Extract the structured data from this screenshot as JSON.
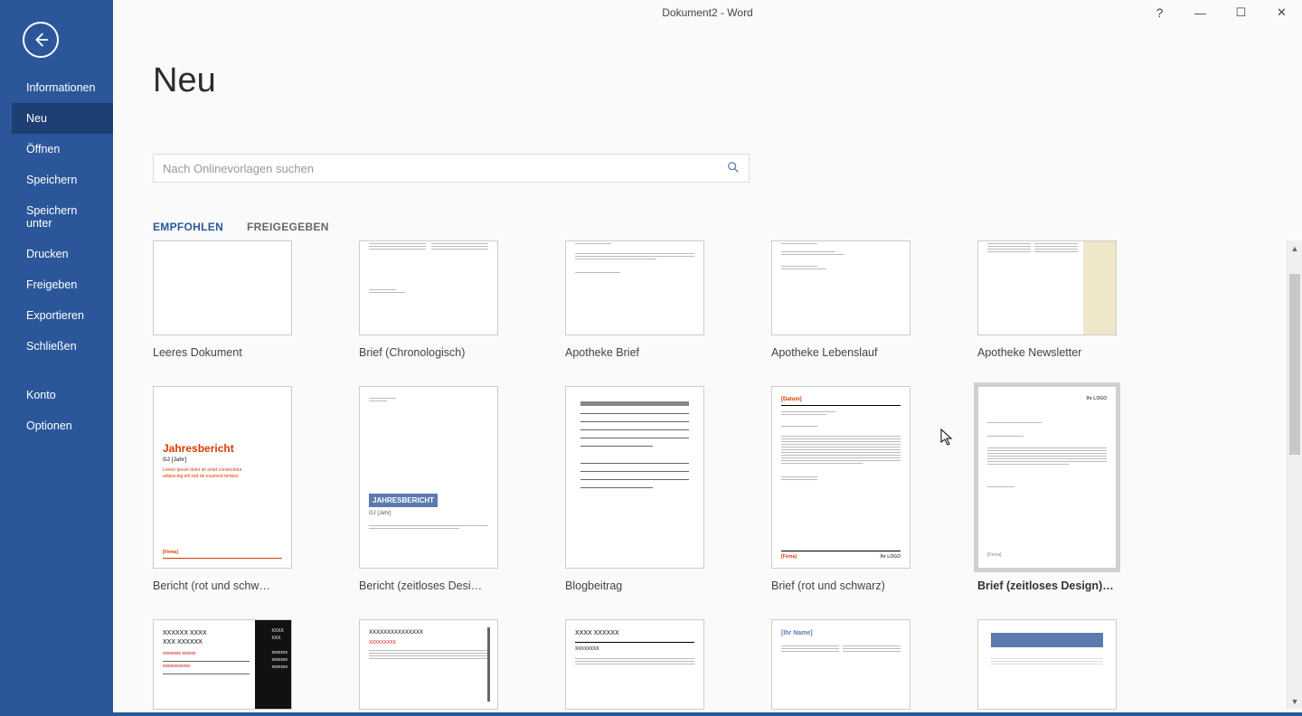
{
  "window_title": "Dokument2 - Word",
  "help_glyph": "?",
  "min_glyph": "—",
  "max_glyph": "☐",
  "close_glyph": "✕",
  "sidebar": {
    "items": [
      {
        "label": "Informationen"
      },
      {
        "label": "Neu"
      },
      {
        "label": "Öffnen"
      },
      {
        "label": "Speichern"
      },
      {
        "label": "Speichern unter"
      },
      {
        "label": "Drucken"
      },
      {
        "label": "Freigeben"
      },
      {
        "label": "Exportieren"
      },
      {
        "label": "Schließen"
      },
      {
        "label": "Konto"
      },
      {
        "label": "Optionen"
      }
    ],
    "active_index": 1
  },
  "heading": "Neu",
  "search_placeholder": "Nach Onlinevorlagen suchen",
  "tabs": [
    {
      "label": "EMPFOHLEN",
      "selected": true
    },
    {
      "label": "FREIGEGEBEN",
      "selected": false
    }
  ],
  "templates_row1": [
    {
      "label": "Leeres Dokument"
    },
    {
      "label": "Brief (Chronologisch)"
    },
    {
      "label": "Apotheke Brief"
    },
    {
      "label": "Apotheke Lebenslauf"
    },
    {
      "label": "Apotheke Newsletter"
    }
  ],
  "templates_row2": [
    {
      "label": "Bericht (rot und schw…"
    },
    {
      "label": "Bericht (zeitloses Desi…"
    },
    {
      "label": "Blogbeitrag"
    },
    {
      "label": "Brief (rot und schwarz)"
    },
    {
      "label": "Brief (zeitloses Design)",
      "hovered": true
    }
  ],
  "pin_glyph": "📌",
  "thumb_text": {
    "jahresbericht": "Jahresbericht",
    "gj": "GJ [Jahr]",
    "jah2": "JAHRESBERICHT",
    "logo": "LOGO",
    "ihr_name": "[Ihr Name]",
    "firma": "[Firma]",
    "datum": "[Datum]",
    "xrow": "XXXXXX XXXX",
    "xrow2": "XXX XXXXXX"
  }
}
